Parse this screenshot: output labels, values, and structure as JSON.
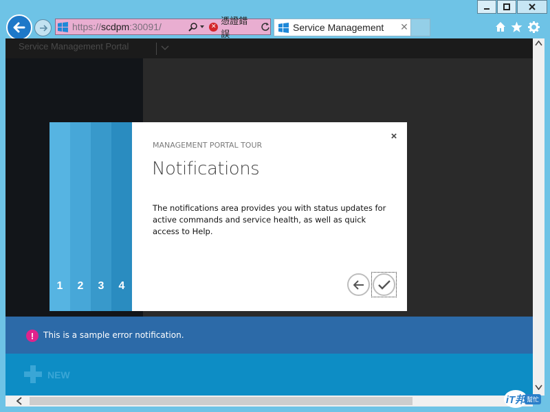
{
  "browser": {
    "address": {
      "scheme": "https://",
      "host": "scdpm",
      "port_path": ":30091/"
    },
    "cert_error": "憑證錯誤",
    "tab_title": "Service Management"
  },
  "portal": {
    "title": "Service Management Portal",
    "notification_text": "This is a sample error notification.",
    "notification_icon": "!",
    "new_label": "NEW"
  },
  "tour": {
    "label": "MANAGEMENT PORTAL TOUR",
    "title": "Notifications",
    "description": "The notifications area provides you with status updates for active commands and service health, as well as quick access to Help.",
    "steps": [
      {
        "num": "1",
        "color": "#56b4e2"
      },
      {
        "num": "2",
        "color": "#47a7d8"
      },
      {
        "num": "3",
        "color": "#3899cb"
      },
      {
        "num": "4",
        "color": "#2a8cc0"
      }
    ],
    "close_glyph": "×"
  },
  "watermark": {
    "logo": "iT邦",
    "tag": "幫忙"
  },
  "colors": {
    "chrome": "#6ec3e6",
    "notification_bar": "#2c6aa8",
    "command_bar": "#0d8dc5",
    "error_accent": "#e0238c"
  }
}
